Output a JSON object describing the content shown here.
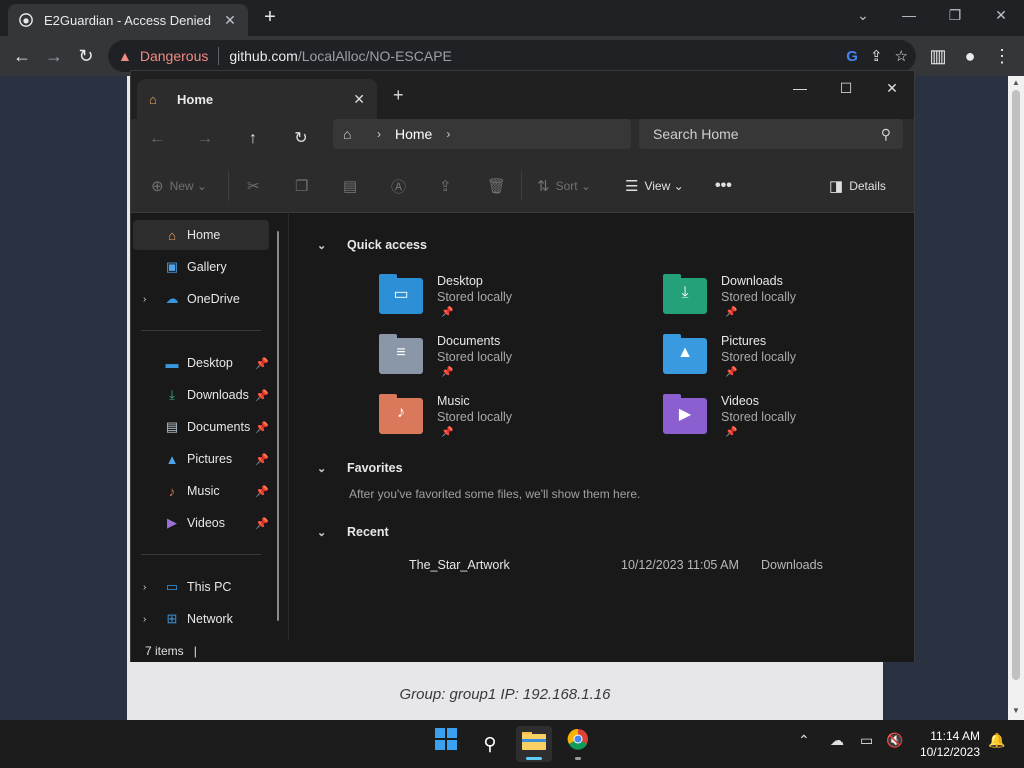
{
  "browser": {
    "tab_title": "E2Guardian - Access Denied",
    "security_label": "Dangerous",
    "url_host": "github.com",
    "url_path": "/LocalAlloc/NO-ESCAPE"
  },
  "page": {
    "footer": "Group: group1   IP: 192.168.1.16"
  },
  "explorer": {
    "tab_label": "Home",
    "breadcrumb": "Home",
    "search_placeholder": "Search Home",
    "commands": {
      "new": "New",
      "sort": "Sort",
      "view": "View",
      "details": "Details"
    },
    "nav": [
      {
        "label": "Home"
      },
      {
        "label": "Gallery"
      },
      {
        "label": "OneDrive"
      },
      {
        "label": "Desktop"
      },
      {
        "label": "Downloads"
      },
      {
        "label": "Documents"
      },
      {
        "label": "Pictures"
      },
      {
        "label": "Music"
      },
      {
        "label": "Videos"
      },
      {
        "label": "This PC"
      },
      {
        "label": "Network"
      }
    ],
    "sections": {
      "quick_access": "Quick access",
      "favorites": "Favorites",
      "recent": "Recent"
    },
    "quick_access": [
      {
        "name": "Desktop",
        "sub": "Stored locally"
      },
      {
        "name": "Downloads",
        "sub": "Stored locally"
      },
      {
        "name": "Documents",
        "sub": "Stored locally"
      },
      {
        "name": "Pictures",
        "sub": "Stored locally"
      },
      {
        "name": "Music",
        "sub": "Stored locally"
      },
      {
        "name": "Videos",
        "sub": "Stored locally"
      }
    ],
    "favorites_empty": "After you've favorited some files, we'll show them here.",
    "recent": [
      {
        "name": "The_Star_Artwork",
        "date": "10/12/2023 11:05 AM",
        "location": "Downloads"
      }
    ],
    "status": "7 items"
  },
  "taskbar": {
    "time": "11:14 AM",
    "date": "10/12/2023"
  }
}
